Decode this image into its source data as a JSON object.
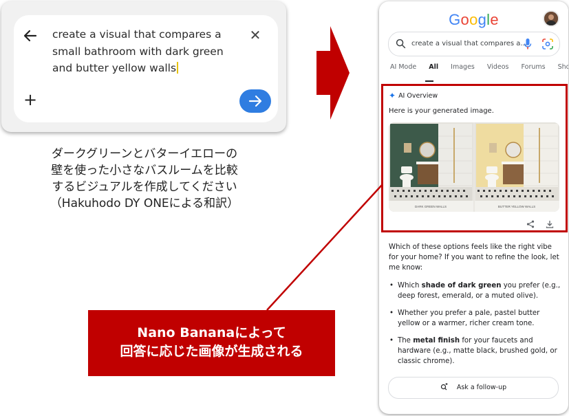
{
  "input_panel": {
    "prompt_text": "create a visual that compares a small bathroom with dark green and butter yellow walls",
    "icons": [
      "back-arrow-icon",
      "close-icon",
      "plus-icon",
      "send-arrow-icon"
    ]
  },
  "caption": {
    "lines": [
      "ダークグリーンとバターイエローの",
      "壁を使った小さなバスルームを比較",
      "するビジュアルを作成してください",
      "（Hakuhodo DY ONEによる和訳）"
    ]
  },
  "phone": {
    "logo": "Google",
    "search": {
      "value": "create a visual that compares a..."
    },
    "tabs": [
      {
        "label": "AI Mode"
      },
      {
        "label": "All",
        "active": true
      },
      {
        "label": "Images"
      },
      {
        "label": "Videos"
      },
      {
        "label": "Forums"
      },
      {
        "label": "Shopping"
      }
    ],
    "ai_overview": {
      "title": "AI Overview",
      "intro": "Here is your generated image.",
      "image_labels": {
        "left": "DARK GREEN WALLS",
        "right": "BUTTER YELLOW WALLS"
      }
    },
    "question": "Which of these options feels like the right vibe for your home? If you want to refine the look, let me know:",
    "bullets": [
      {
        "before": "Which ",
        "bold": "shade of dark green",
        "after": " you prefer (e.g., deep forest, emerald, or a muted olive)."
      },
      {
        "before": "Whether you prefer a pale, pastel butter yellow or a warmer, richer cream tone.",
        "bold": "",
        "after": ""
      },
      {
        "before": "The ",
        "bold": "metal finish",
        "after": " for your faucets and hardware (e.g., matte black, brushed gold, or classic chrome)."
      }
    ],
    "followup_label": "Ask a follow-up"
  },
  "callout": {
    "line1": "Nano Bananaによって",
    "line2": "回答に応じた画像が生成される"
  },
  "colors": {
    "accent_red": "#c00000",
    "google_blue": "#1a73e8",
    "send_button": "#2f7de1",
    "dark_green_wall": "#3d5a4a",
    "butter_yellow_wall": "#efdca0"
  }
}
